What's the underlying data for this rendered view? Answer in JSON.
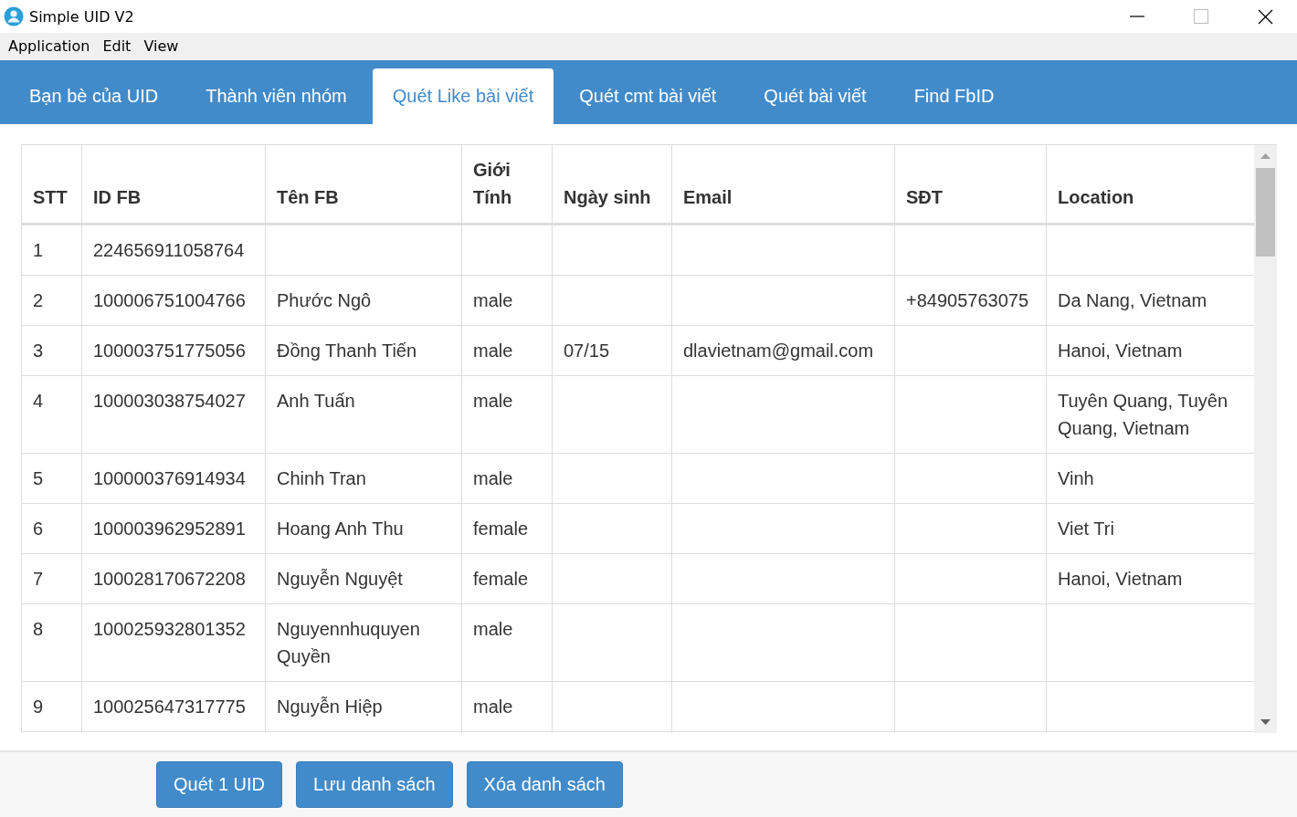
{
  "window": {
    "title": "Simple UID V2"
  },
  "menu": [
    "Application",
    "Edit",
    "View"
  ],
  "tabs": [
    {
      "label": "Bạn bè của UID",
      "selected": false
    },
    {
      "label": "Thành viên nhóm",
      "selected": false
    },
    {
      "label": "Quét Like bài viết",
      "selected": true
    },
    {
      "label": "Quét cmt bài viết",
      "selected": false
    },
    {
      "label": "Quét bài viết",
      "selected": false
    },
    {
      "label": "Find FbID",
      "selected": false
    }
  ],
  "table": {
    "columns": [
      "STT",
      "ID FB",
      "Tên FB",
      "Giới Tính",
      "Ngày sinh",
      "Email",
      "SĐT",
      "Location"
    ],
    "rows": [
      [
        "1",
        "224656911058764",
        "",
        "",
        "",
        "",
        "",
        ""
      ],
      [
        "2",
        "100006751004766",
        "Phước Ngô",
        "male",
        "",
        "",
        "+84905763075",
        "Da Nang, Vietnam"
      ],
      [
        "3",
        "100003751775056",
        "Đồng Thanh Tiến",
        "male",
        "07/15",
        "dlavietnam@gmail.com",
        "",
        "Hanoi, Vietnam"
      ],
      [
        "4",
        "100003038754027",
        "Anh Tuấn",
        "male",
        "",
        "",
        "",
        "Tuyên Quang, Tuyên Quang, Vietnam"
      ],
      [
        "5",
        "100000376914934",
        "Chinh Tran",
        "male",
        "",
        "",
        "",
        "Vinh"
      ],
      [
        "6",
        "100003962952891",
        "Hoang Anh Thu",
        "female",
        "",
        "",
        "",
        "Viet Tri"
      ],
      [
        "7",
        "100028170672208",
        "Nguyễn Nguyệt",
        "female",
        "",
        "",
        "",
        "Hanoi, Vietnam"
      ],
      [
        "8",
        "100025932801352",
        "Nguyennhuquyen Quyền",
        "male",
        "",
        "",
        "",
        ""
      ],
      [
        "9",
        "100025647317775",
        "Nguyễn Hiệp",
        "male",
        "",
        "",
        "",
        ""
      ]
    ]
  },
  "buttons": [
    "Quét 1 UID",
    "Lưu danh sách",
    "Xóa danh sách"
  ]
}
